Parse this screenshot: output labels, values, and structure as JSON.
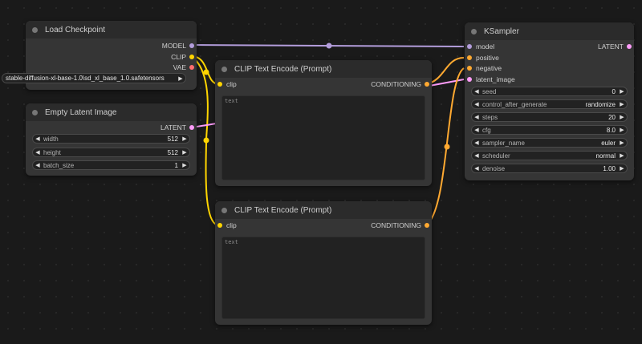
{
  "colors": {
    "model": "#b39ddb",
    "clip": "#ffd500",
    "vae": "#ff6e6e",
    "conditioning": "#ffa931",
    "latent": "#ff9cf9"
  },
  "load_checkpoint": {
    "title": "Load Checkpoint",
    "outputs": {
      "model": "MODEL",
      "clip": "CLIP",
      "vae": "VAE"
    },
    "ckpt_name": "stable-diffusion-xl-base-1.0\\sd_xl_base_1.0.safetensors"
  },
  "empty_latent": {
    "title": "Empty Latent Image",
    "output": "LATENT",
    "widgets": [
      {
        "label": "width",
        "value": "512"
      },
      {
        "label": "height",
        "value": "512"
      },
      {
        "label": "batch_size",
        "value": "1"
      }
    ]
  },
  "clip_pos": {
    "title": "CLIP Text Encode (Prompt)",
    "input": "clip",
    "output": "CONDITIONING",
    "placeholder": "text"
  },
  "clip_neg": {
    "title": "CLIP Text Encode (Prompt)",
    "input": "clip",
    "output": "CONDITIONING",
    "placeholder": "text"
  },
  "ksampler": {
    "title": "KSampler",
    "inputs": {
      "model": "model",
      "positive": "positive",
      "negative": "negative",
      "latent_image": "latent_image"
    },
    "output": "LATENT",
    "widgets": [
      {
        "label": "seed",
        "value": "0"
      },
      {
        "label": "control_after_generate",
        "value": "randomize"
      },
      {
        "label": "steps",
        "value": "20"
      },
      {
        "label": "cfg",
        "value": "8.0"
      },
      {
        "label": "sampler_name",
        "value": "euler"
      },
      {
        "label": "scheduler",
        "value": "normal"
      },
      {
        "label": "denoise",
        "value": "1.00"
      }
    ]
  }
}
